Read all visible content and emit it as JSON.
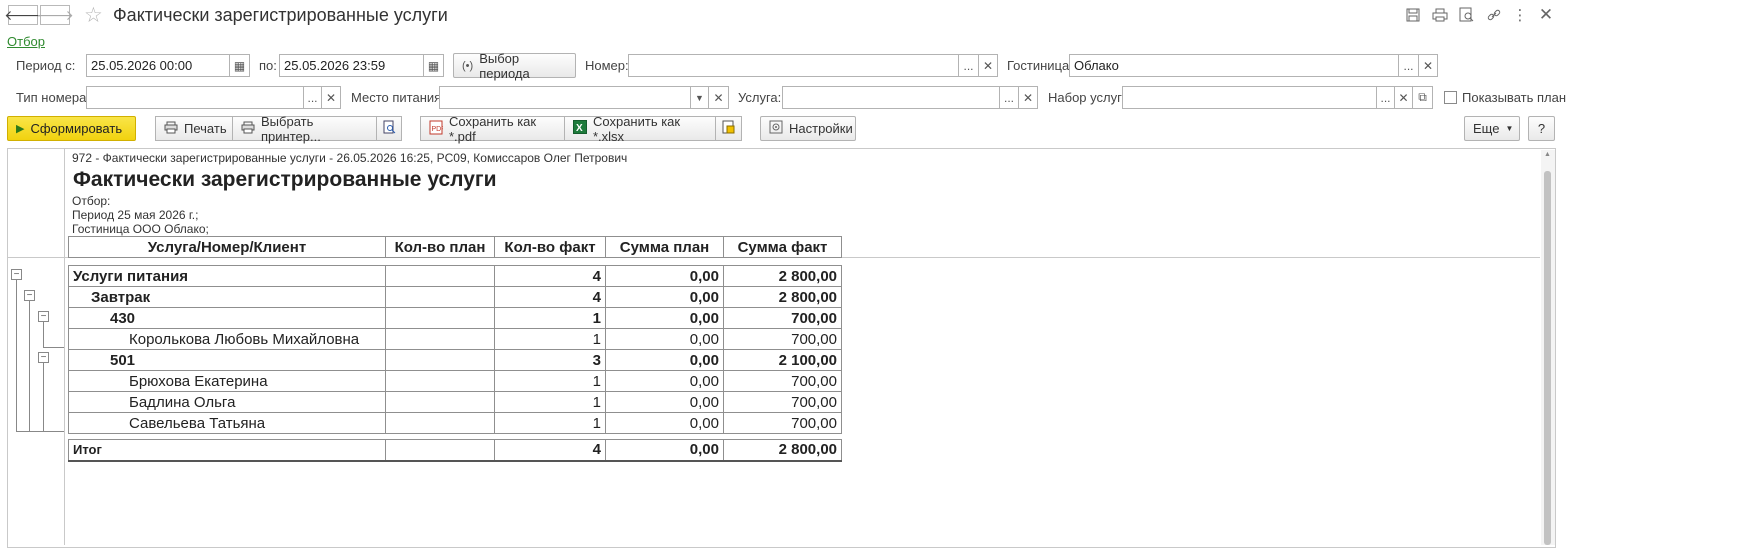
{
  "window": {
    "title": "Фактически зарегистрированные услуги",
    "filter_link": "Отбор"
  },
  "filters": {
    "period_from_label": "Период с:",
    "period_from_value": "25.05.2026 00:00",
    "period_to_label": "по:",
    "period_to_value": "25.05.2026 23:59",
    "period_button": "Выбор периода",
    "room_label": "Номер:",
    "room_value": "",
    "hotel_label": "Гостиница:",
    "hotel_value": "Облако",
    "room_type_label": "Тип номера:",
    "room_type_value": "",
    "meal_place_label": "Место питания:",
    "meal_place_value": "",
    "service_label": "Услуга:",
    "service_value": "",
    "service_set_label": "Набор услуг:",
    "service_set_value": "",
    "show_plan_label": "Показывать план"
  },
  "toolbar": {
    "generate": "Сформировать",
    "print": "Печать",
    "choose_printer": "Выбрать принтер...",
    "save_pdf": "Сохранить как *.pdf",
    "save_xlsx": "Сохранить как *.xlsx",
    "settings": "Настройки",
    "more": "Еще",
    "help": "?"
  },
  "report": {
    "meta": "972 - Фактически зарегистрированные услуги - 26.05.2026 16:25, PC09, Комиссаров Олег Петрович",
    "heading": "Фактически зарегистрированные услуги",
    "filter_caption": "Отбор:",
    "period_line": "Период 25 мая 2026 г.;",
    "hotel_line": "Гостиница ООО Облако;",
    "columns": [
      "Услуга/Номер/Клиент",
      "Кол-во план",
      "Кол-во факт",
      "Сумма план",
      "Сумма факт"
    ],
    "rows": [
      {
        "name": "Услуги питания",
        "plan_qty": "",
        "fact_qty": "4",
        "plan_sum": "0,00",
        "fact_sum": "2 800,00"
      },
      {
        "name": "Завтрак",
        "plan_qty": "",
        "fact_qty": "4",
        "plan_sum": "0,00",
        "fact_sum": "2 800,00"
      },
      {
        "name": "430",
        "plan_qty": "",
        "fact_qty": "1",
        "plan_sum": "0,00",
        "fact_sum": "700,00"
      },
      {
        "name": "Королькова Любовь Михайловна",
        "plan_qty": "",
        "fact_qty": "1",
        "plan_sum": "0,00",
        "fact_sum": "700,00"
      },
      {
        "name": "501",
        "plan_qty": "",
        "fact_qty": "3",
        "plan_sum": "0,00",
        "fact_sum": "2 100,00"
      },
      {
        "name": "Брюхова Екатерина",
        "plan_qty": "",
        "fact_qty": "1",
        "plan_sum": "0,00",
        "fact_sum": "700,00"
      },
      {
        "name": "Бадлина Ольга",
        "plan_qty": "",
        "fact_qty": "1",
        "plan_sum": "0,00",
        "fact_sum": "700,00"
      },
      {
        "name": "Савельева Татьяна",
        "plan_qty": "",
        "fact_qty": "1",
        "plan_sum": "0,00",
        "fact_sum": "700,00"
      }
    ],
    "total": {
      "name": "Итог",
      "plan_qty": "",
      "fact_qty": "4",
      "plan_sum": "0,00",
      "fact_sum": "2 800,00"
    }
  },
  "colors": {
    "primary_button": "#f1d20f",
    "link": "#2f8a2f"
  }
}
